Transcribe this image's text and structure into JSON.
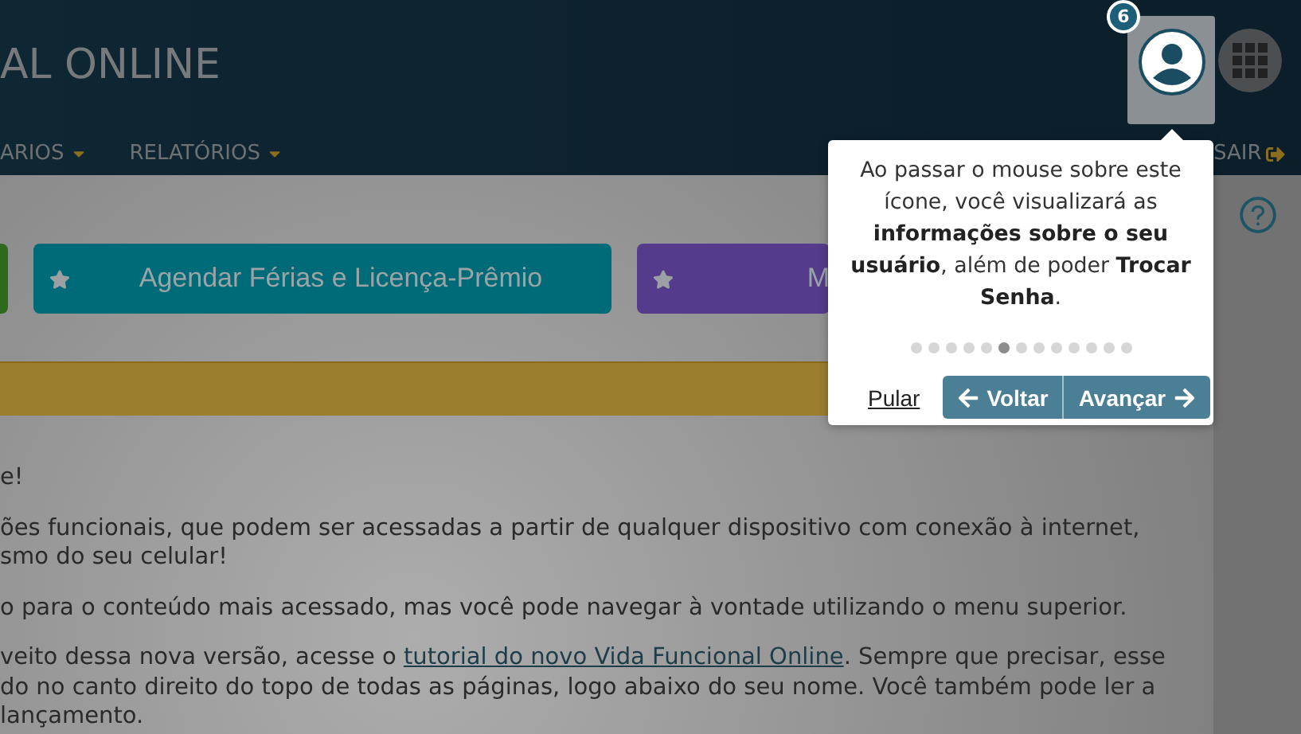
{
  "header": {
    "title": "AL ONLINE",
    "nav": [
      {
        "label": "ARIOS"
      },
      {
        "label": "RELATÓRIOS"
      }
    ],
    "logout": "SAIR"
  },
  "user_badge": "6",
  "tour": {
    "text": "Ao passar o mouse sobre este ícone, você visualizará as **informações sobre o seu usuário**, além de poder **Trocar Senha**.",
    "dots": [
      {
        "selected": false
      },
      {
        "selected": false
      },
      {
        "selected": false
      },
      {
        "selected": false
      },
      {
        "selected": false
      },
      {
        "selected": true
      },
      {
        "selected": false
      },
      {
        "selected": false
      },
      {
        "selected": false
      },
      {
        "selected": false
      },
      {
        "selected": false
      },
      {
        "selected": false
      },
      {
        "selected": false
      }
    ],
    "skip": "Pular",
    "back": "Voltar",
    "next": "Avançar"
  },
  "quick_actions": [
    {
      "color": "#2f6a1c"
    },
    {
      "label": "Agendar Férias e Licença-Prêmio",
      "color": "#006b78"
    },
    {
      "label": "M",
      "color": "#553b8c"
    }
  ],
  "paragraphs": [
    {
      "lines": [
        [
          {
            "text": "e!"
          }
        ]
      ]
    },
    {
      "lines": [
        [
          {
            "text": "ões funcionais, que podem ser acessadas a partir de qualquer dispositivo com conexão à internet,"
          }
        ],
        [
          {
            "text": "smo do seu celular!"
          }
        ]
      ]
    },
    {
      "lines": [
        [
          {
            "text": "o para o conteúdo mais acessado, mas você pode navegar à vontade utilizando o menu superior."
          }
        ]
      ]
    },
    {
      "lines": [
        [
          {
            "text": "veito dessa nova versão, acesse o "
          },
          {
            "text": "tutorial do novo Vida Funcional Online",
            "kind": "link"
          },
          {
            "text": ". Sempre que precisar, esse"
          }
        ],
        [
          {
            "text": "do no canto direito do topo de todas as páginas, logo abaixo do seu nome. Você também pode ler a"
          }
        ],
        [
          {
            "text": "lançamento."
          }
        ]
      ]
    }
  ]
}
